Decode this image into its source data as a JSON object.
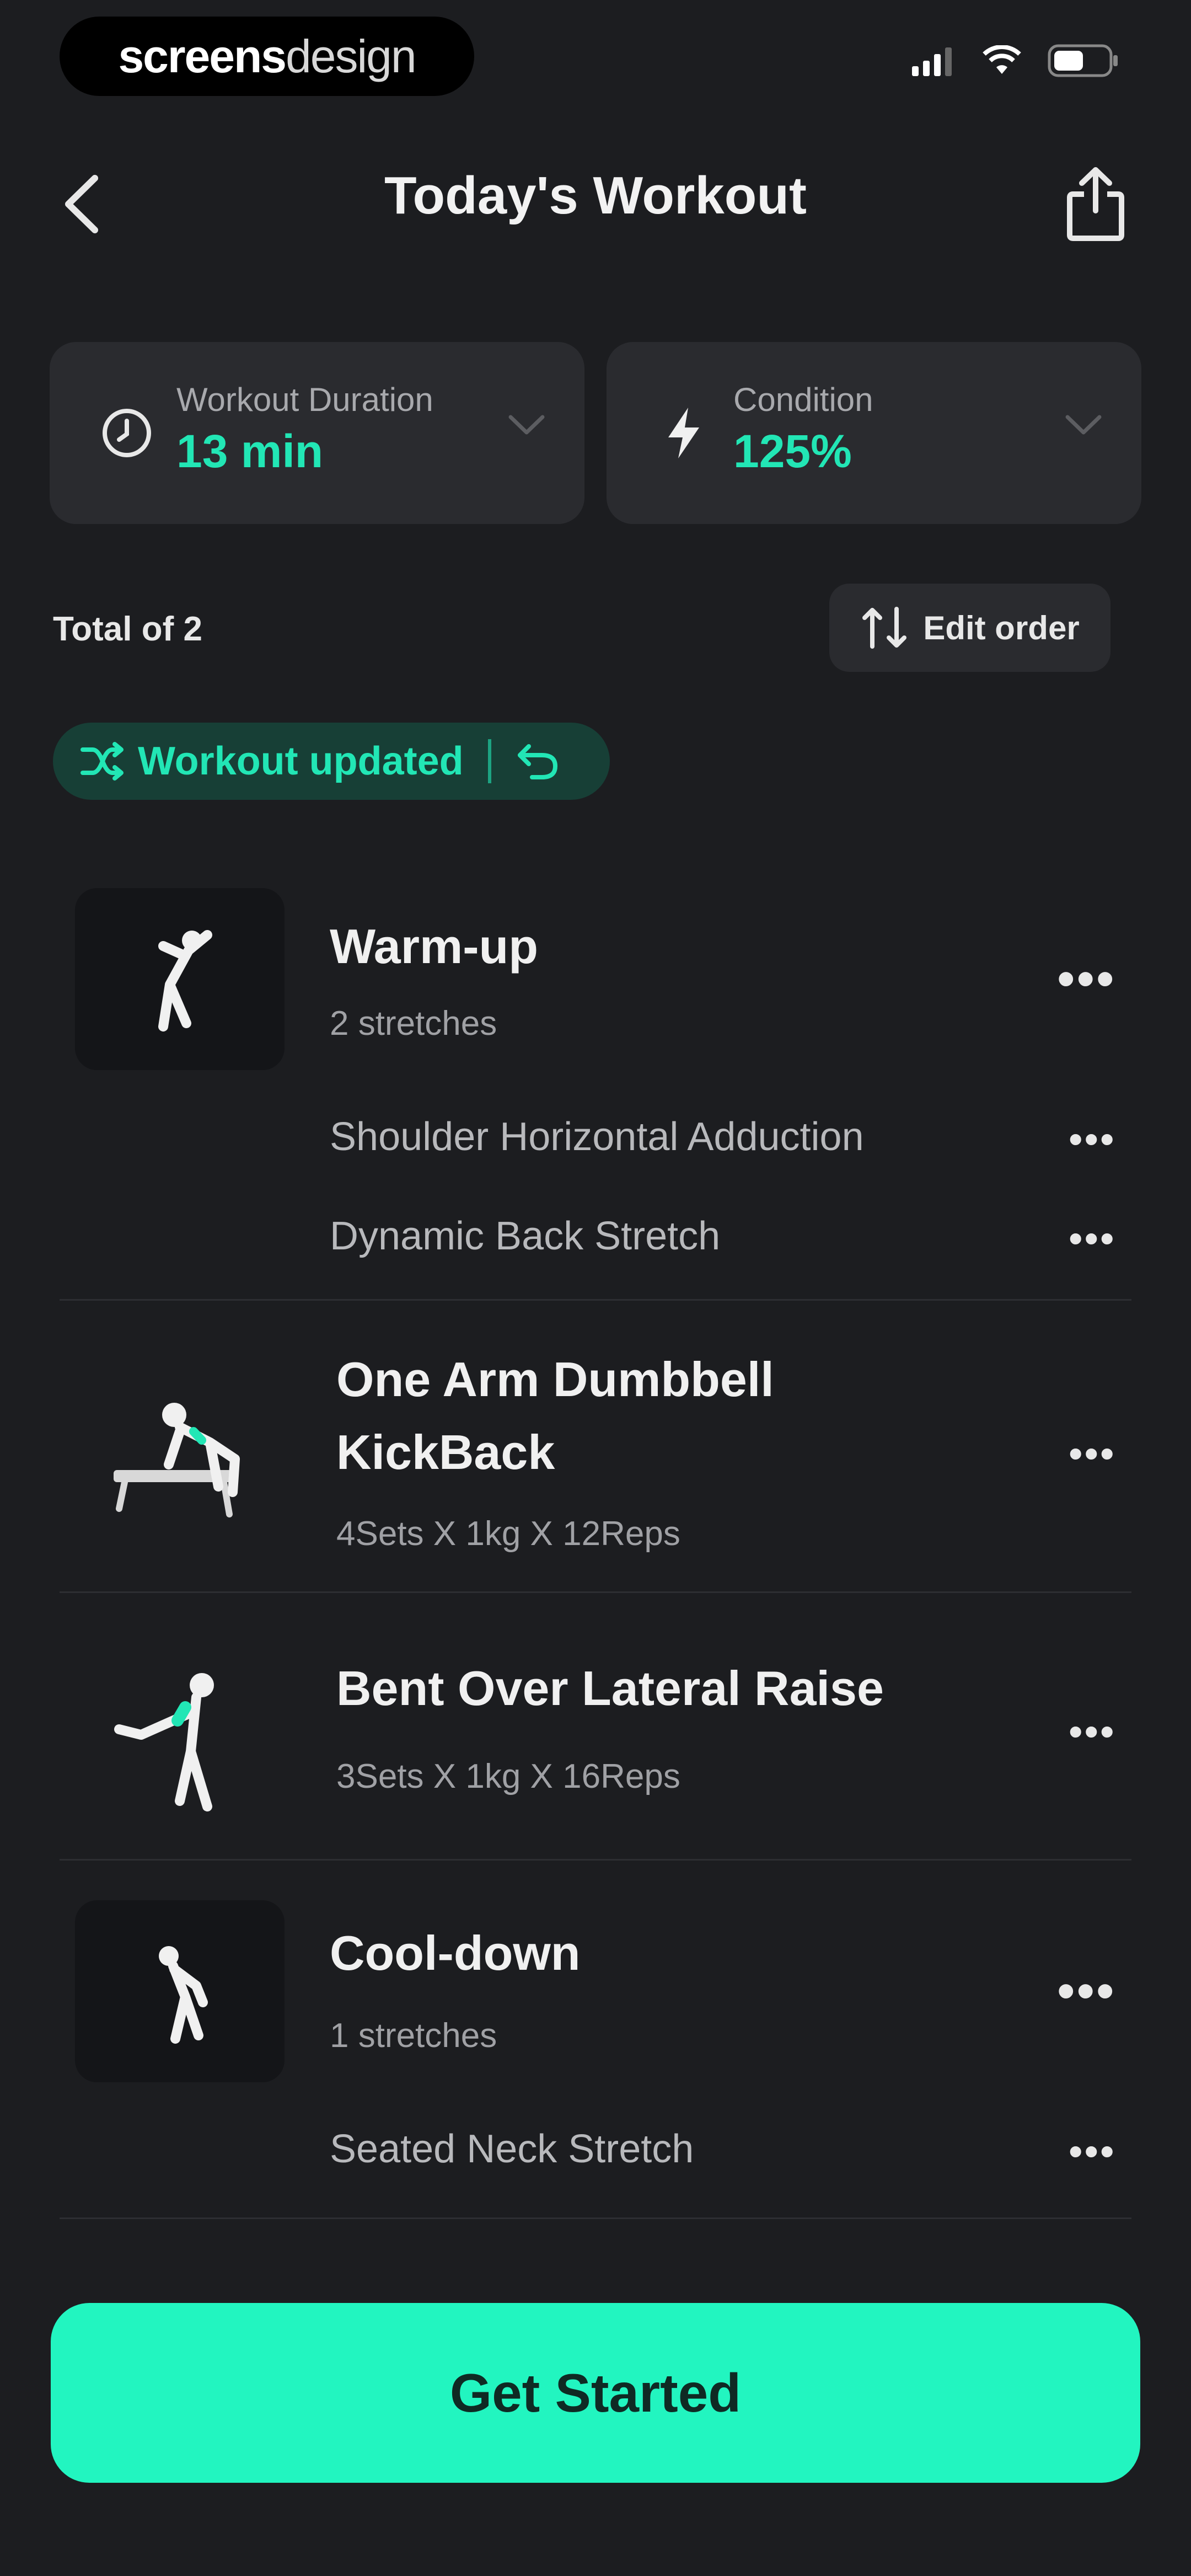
{
  "status_bar": {
    "brand_bold": "screens",
    "brand_light": "design"
  },
  "header": {
    "title": "Today's Workout"
  },
  "stats": {
    "duration": {
      "label": "Workout Duration",
      "value": "13 min"
    },
    "condition": {
      "label": "Condition",
      "value": "125%"
    }
  },
  "summary": {
    "total": "Total of 2",
    "edit_order": "Edit order"
  },
  "notice": {
    "text": "Workout updated"
  },
  "items": {
    "warmup": {
      "title": "Warm-up",
      "sub": "2 stretches",
      "stretches": [
        "Shoulder Horizontal Adduction",
        "Dynamic Back Stretch"
      ]
    },
    "ex1": {
      "title_line1": "One Arm Dumbbell",
      "title_line2": "KickBack",
      "sub": "4Sets X 1kg X 12Reps"
    },
    "ex2": {
      "title": "Bent Over Lateral Raise",
      "sub": "3Sets X 1kg X 16Reps"
    },
    "cooldown": {
      "title": "Cool-down",
      "sub": "1 stretches",
      "stretches": [
        "Seated Neck Stretch"
      ]
    }
  },
  "cta": {
    "label": "Get Started"
  },
  "colors": {
    "accent": "#22e6b5",
    "cta_bg": "#22f5c0",
    "background": "#1c1d20",
    "card": "#2a2b2f"
  }
}
